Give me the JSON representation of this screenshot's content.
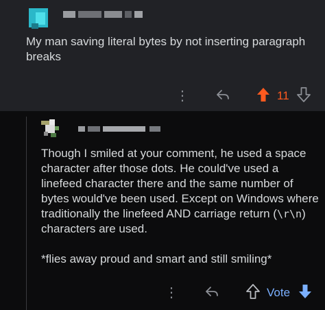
{
  "parent_comment": {
    "text": "My man saving literal bytes by not inserting paragraph breaks",
    "score": "11"
  },
  "reply_comment": {
    "paragraph1_before_code": "Though I smiled at your comment, he used a space character after those dots. He could've used a linefeed character there and the same number of bytes would've been used. Except on Windows where traditionally the linefeed AND carriage return (",
    "code": "\\r\\n",
    "paragraph1_after_code": ") characters are used.",
    "paragraph2": "*flies away proud and smart and still smiling*",
    "vote_label": "Vote"
  },
  "colors": {
    "background": "#0c0c0d",
    "parent_background": "#212226",
    "upvoted": "#ff5a1f",
    "vote_accent": "#7bb0ff"
  },
  "icons": {
    "more": "more-options-icon",
    "reply": "reply-icon",
    "upvote": "upvote-arrow-icon",
    "downvote": "downvote-arrow-icon"
  }
}
